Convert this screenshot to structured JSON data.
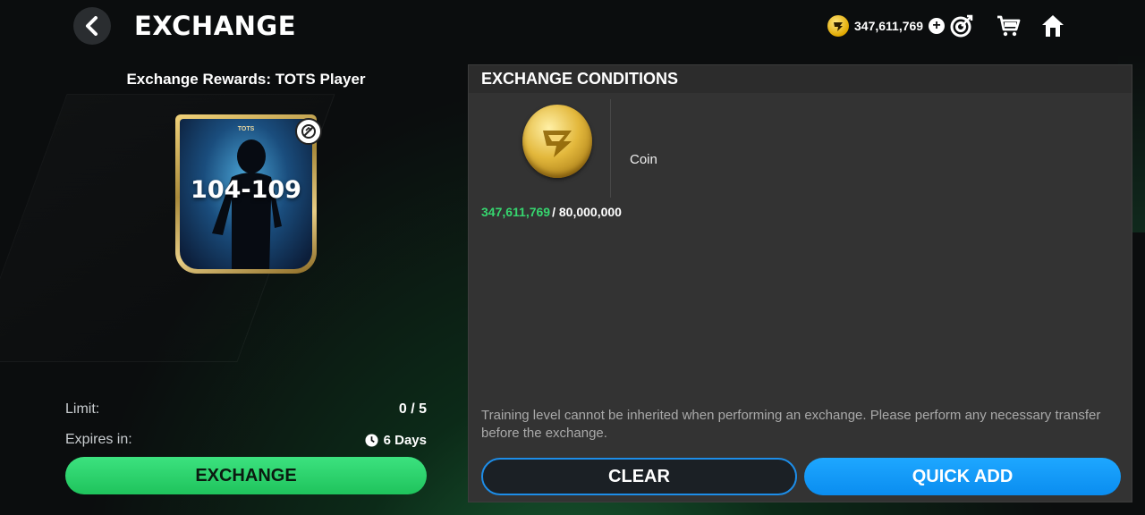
{
  "header": {
    "title": "EXCHANGE",
    "currency_amount": "347,611,769",
    "icons": [
      "back-icon",
      "coin-icon",
      "plus-icon",
      "target-icon",
      "cart-icon",
      "home-icon"
    ]
  },
  "reward": {
    "label": "Exchange Rewards:  TOTS Player",
    "card_program": "TOTS",
    "card_rating": "104-109"
  },
  "info": {
    "limit_label": "Limit:",
    "limit_value": "0 / 5",
    "expires_label": "Expires in:",
    "expires_value": "6 Days"
  },
  "buttons": {
    "exchange": "EXCHANGE",
    "clear": "CLEAR",
    "quick_add": "QUICK ADD"
  },
  "conditions": {
    "header": "EXCHANGE CONDITIONS",
    "items": [
      {
        "name": "Coin",
        "have": "347,611,769",
        "need": "/ 80,000,000"
      }
    ],
    "notice": "Training level cannot be inherited when performing an exchange. Please perform any necessary transfer before the exchange."
  },
  "colors": {
    "accent_green": "#1fc35c",
    "accent_blue": "#0a8df0",
    "progress_have": "#36d66f",
    "panel_bg": "#333333"
  }
}
